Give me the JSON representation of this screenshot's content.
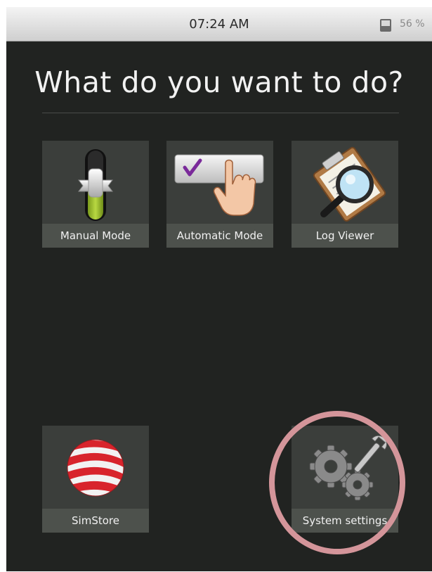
{
  "status_bar": {
    "time": "07:24 AM",
    "battery": "56 %"
  },
  "heading": "What do you want to do?",
  "tiles": [
    {
      "label": "Manual Mode",
      "icon": "toggle-switch-icon"
    },
    {
      "label": "Automatic Mode",
      "icon": "touch-check-button-icon"
    },
    {
      "label": "Log Viewer",
      "icon": "clipboard-magnifier-icon"
    },
    {
      "label": "SimStore",
      "icon": "red-striped-sphere-logo"
    },
    {
      "label": "System settings",
      "icon": "gears-wrench-icon"
    }
  ],
  "colors": {
    "background": "#212321",
    "tile": "#3b3e3b",
    "tile_label_bar": "#4d514c",
    "highlight_ring": "#d4959a",
    "simstore_red": "#d8242c"
  }
}
